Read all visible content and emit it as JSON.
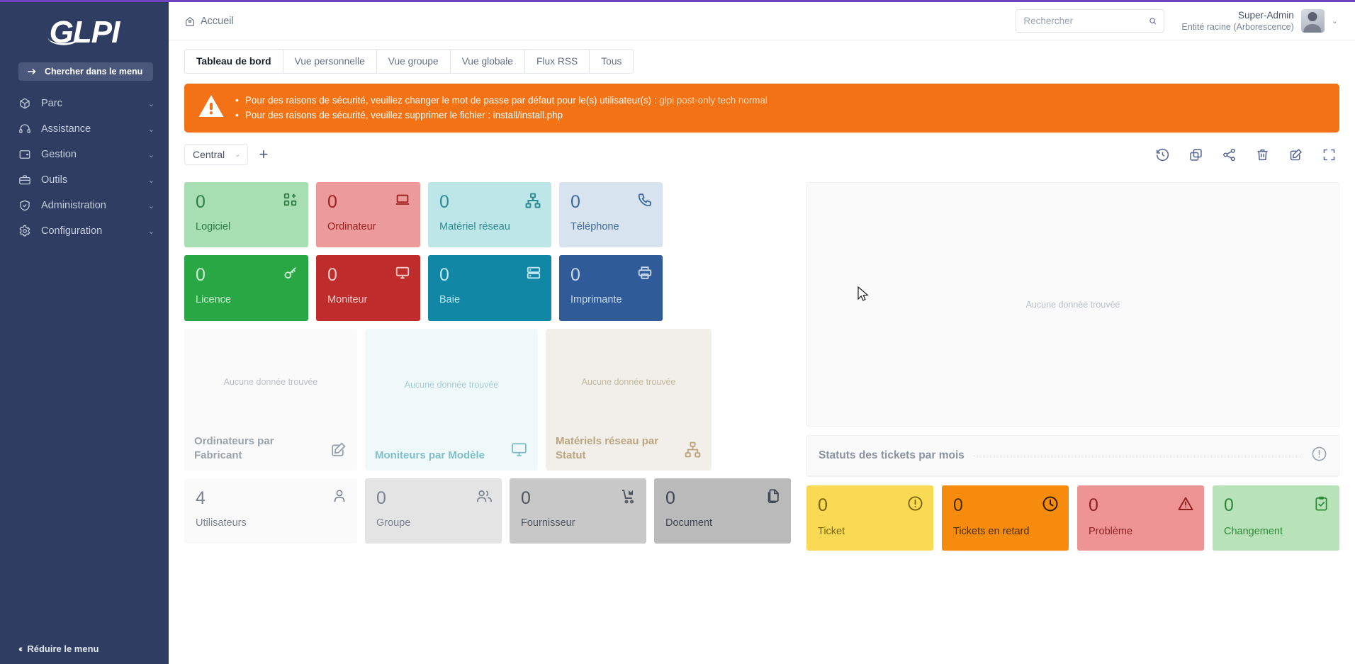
{
  "brand": {
    "logo_text": "GLPI",
    "accent_top": "#6f42c1",
    "sidebar_bg": "#2e3d61"
  },
  "sidebar": {
    "search_label": "Chercher dans le menu",
    "items": [
      {
        "label": "Parc",
        "icon": "box-icon"
      },
      {
        "label": "Assistance",
        "icon": "headset-icon"
      },
      {
        "label": "Gestion",
        "icon": "wallet-icon"
      },
      {
        "label": "Outils",
        "icon": "toolbox-icon"
      },
      {
        "label": "Administration",
        "icon": "shield-check-icon"
      },
      {
        "label": "Configuration",
        "icon": "gear-icon"
      }
    ],
    "collapse_label": "Réduire le menu"
  },
  "topbar": {
    "breadcrumb": "Accueil",
    "search_placeholder": "Rechercher",
    "search_value": "",
    "user_name": "Super-Admin",
    "user_entity": "Entité racine (Arborescence)"
  },
  "tabs": [
    {
      "label": "Tableau de bord",
      "active": true
    },
    {
      "label": "Vue personnelle",
      "active": false
    },
    {
      "label": "Vue groupe",
      "active": false
    },
    {
      "label": "Vue globale",
      "active": false
    },
    {
      "label": "Flux RSS",
      "active": false
    },
    {
      "label": "Tous",
      "active": false
    }
  ],
  "alert": {
    "color": "#f47216",
    "line1_prefix": "Pour des raisons de sécurité, veuillez changer le mot de passe par défaut pour le(s) utilisateur(s) : ",
    "line1_users": "glpi post-only tech normal",
    "line2": "Pour des raisons de sécurité, veuillez supprimer le fichier : install/install.php"
  },
  "dashboard_toolbar": {
    "selected_dashboard": "Central",
    "add_label": "+",
    "icons": [
      {
        "name": "history-icon"
      },
      {
        "name": "copy-icon"
      },
      {
        "name": "share-icon"
      },
      {
        "name": "trash-icon"
      },
      {
        "name": "edit-icon"
      },
      {
        "name": "fullscreen-icon"
      }
    ]
  },
  "nodata_text": "Aucune donnée trouvée",
  "tiles_row1": [
    {
      "value": "0",
      "label": "Logiciel",
      "bg": "#a7dfb3",
      "fg": "#2f7d42",
      "icon": "apps-plus-icon"
    },
    {
      "value": "0",
      "label": "Ordinateur",
      "bg": "#ec9a9a",
      "fg": "#9e2020",
      "icon": "laptop-icon"
    },
    {
      "value": "0",
      "label": "Matériel réseau",
      "bg": "#bde6e8",
      "fg": "#2f8b92",
      "icon": "network-icon"
    },
    {
      "value": "0",
      "label": "Téléphone",
      "bg": "#d7e3ee",
      "fg": "#3f6a95",
      "icon": "phone-icon"
    }
  ],
  "tiles_row2": [
    {
      "value": "0",
      "label": "Licence",
      "bg": "#29a745",
      "fg": "#cdf0d4",
      "icon": "key-icon"
    },
    {
      "value": "0",
      "label": "Moniteur",
      "bg": "#bf2c2c",
      "fg": "#f4cdcd",
      "icon": "monitor-icon"
    },
    {
      "value": "0",
      "label": "Baie",
      "bg": "#1287a5",
      "fg": "#bfe9f4",
      "icon": "rack-icon"
    },
    {
      "value": "0",
      "label": "Imprimante",
      "bg": "#2f5c99",
      "fg": "#ccd9ec",
      "icon": "printer-icon"
    }
  ],
  "charts": [
    {
      "title": "Ordinateurs par Fabricant",
      "bg": "#fafafa",
      "fg": "#9aa3ab",
      "nodata_fg": "#b9bfc9",
      "icon": "edit-square-icon"
    },
    {
      "title": "Moniteurs par Modèle",
      "bg": "#f0f9fa",
      "fg": "#7fbfc9",
      "nodata_fg": "#a8cdd4",
      "icon": "monitor-icon"
    },
    {
      "title": "Matériels réseau par Statut",
      "bg": "#f2efea",
      "fg": "#b9a580",
      "nodata_fg": "#c3b79c",
      "icon": "network-icon"
    }
  ],
  "tiles_row3": [
    {
      "value": "4",
      "label": "Utilisateurs",
      "bg": "#fafafa",
      "fg": "#7b8290",
      "icon": "user-icon"
    },
    {
      "value": "0",
      "label": "Groupe",
      "bg": "#e4e4e4",
      "fg": "#7b8290",
      "icon": "users-icon"
    },
    {
      "value": "0",
      "label": "Fournisseur",
      "bg": "#c8c8c8",
      "fg": "#4f5560",
      "icon": "cart-icon"
    },
    {
      "value": "0",
      "label": "Document",
      "bg": "#bababa",
      "fg": "#3f4550",
      "icon": "documents-icon"
    }
  ],
  "right_panel": {
    "top_nodata": "Aucune donnée trouvée",
    "status_title": "Statuts des tickets par mois",
    "status_icon": "alert-circle-icon"
  },
  "status_tiles": [
    {
      "value": "0",
      "label": "Ticket",
      "bg": "#fada55",
      "fg": "#7a6400",
      "icon": "alert-circle-icon"
    },
    {
      "value": "0",
      "label": "Tickets en retard",
      "bg": "#f68b0e",
      "fg": "#4a2e00",
      "icon": "clock-icon"
    },
    {
      "value": "0",
      "label": "Problème",
      "bg": "#ef9494",
      "fg": "#8e1f1f",
      "icon": "warning-triangle-icon"
    },
    {
      "value": "0",
      "label": "Changement",
      "bg": "#b8e3b8",
      "fg": "#2f8a3c",
      "icon": "clipboard-check-icon"
    }
  ]
}
